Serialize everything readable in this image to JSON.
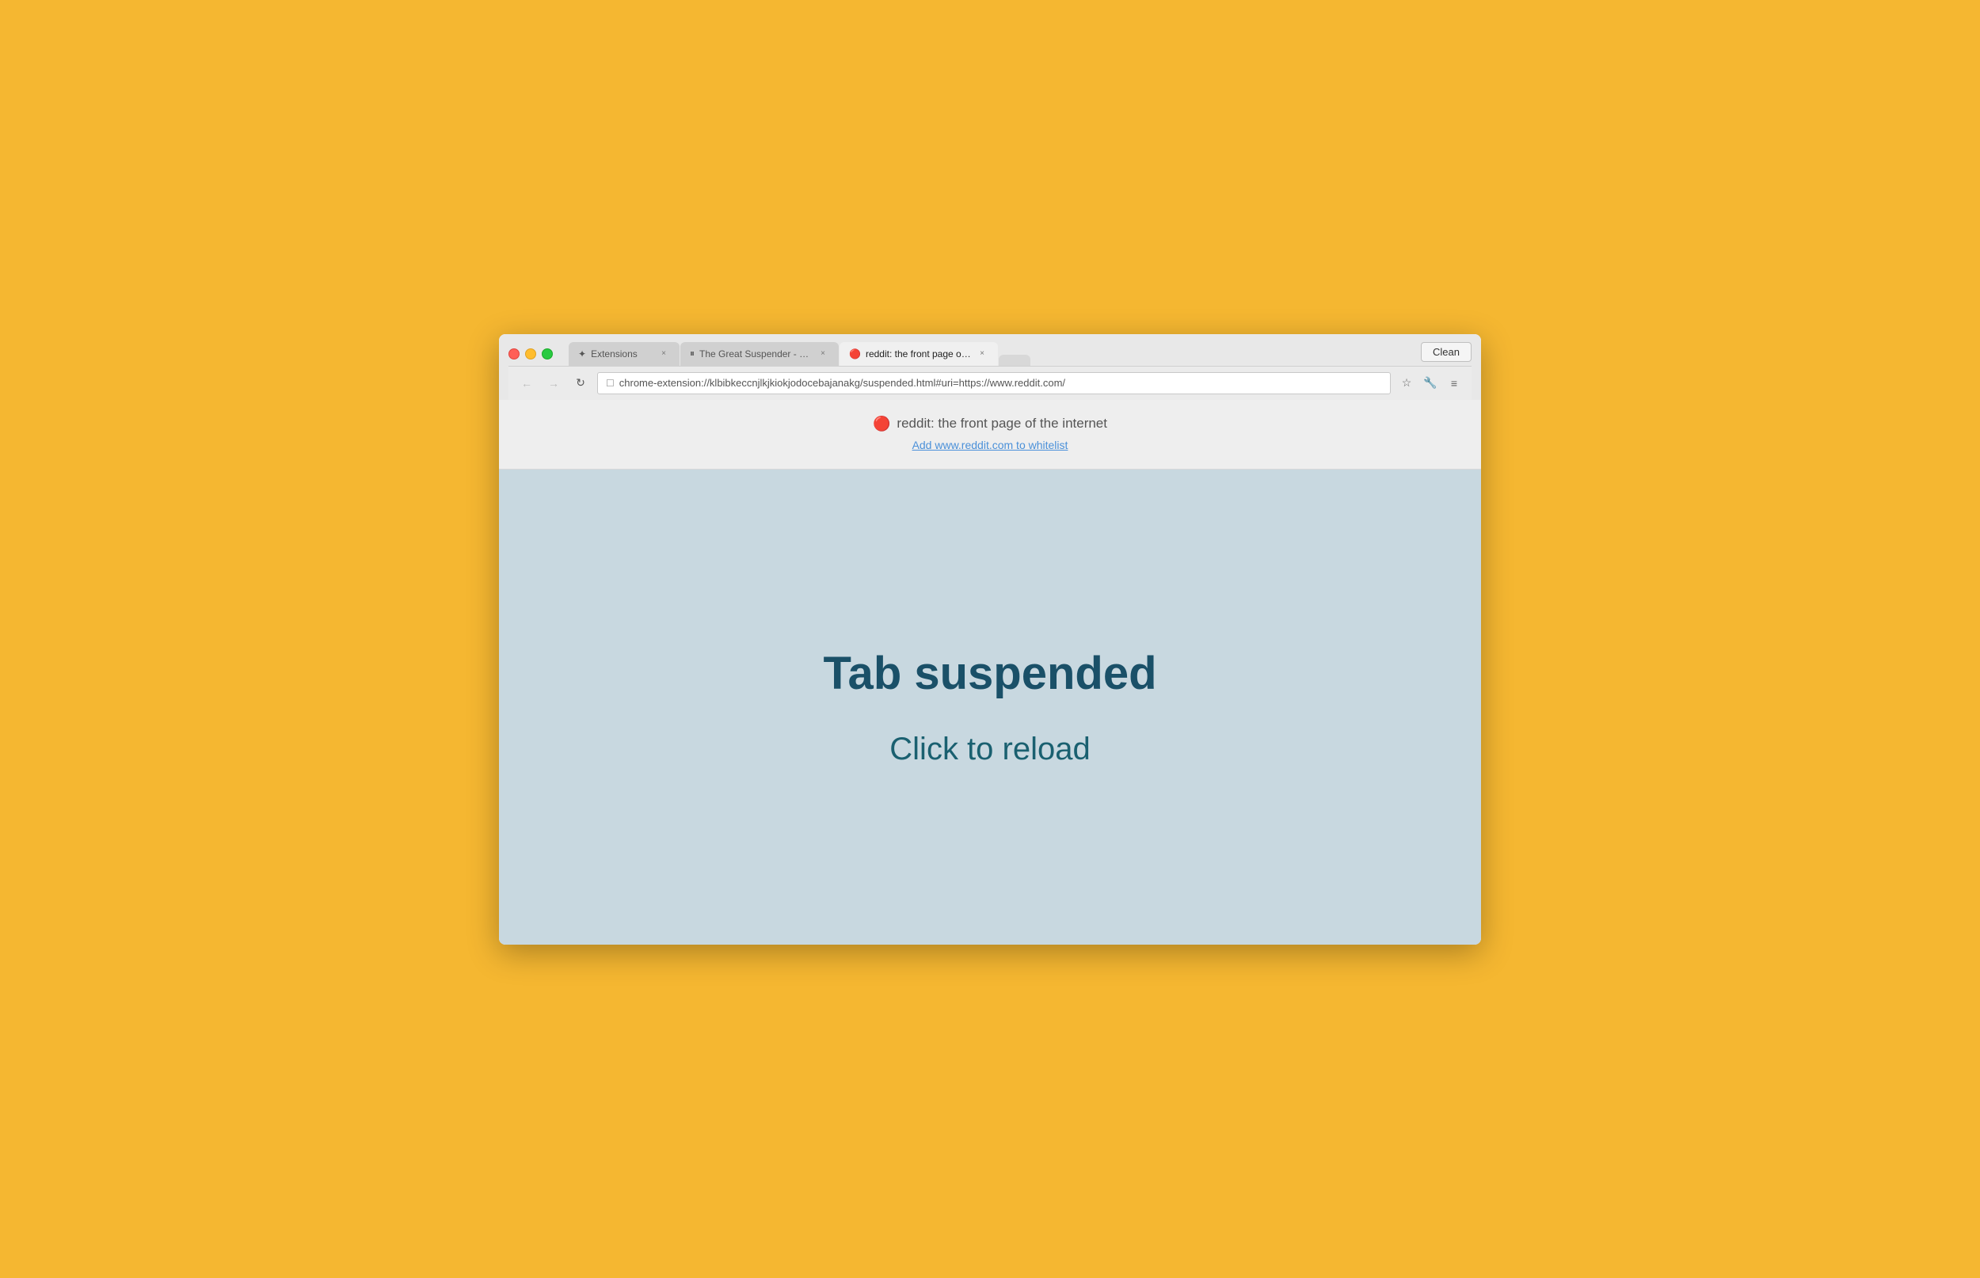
{
  "browser": {
    "background_color": "#F5B731",
    "clean_button_label": "Clean"
  },
  "tabs": [
    {
      "id": "extensions",
      "label": "Extensions",
      "icon": "✦",
      "active": false,
      "close_label": "×"
    },
    {
      "id": "great-suspender",
      "label": "The Great Suspender - Ch…",
      "icon": "⏸",
      "active": false,
      "close_label": "×"
    },
    {
      "id": "reddit",
      "label": "reddit: the front page of th…",
      "icon": "🔴",
      "active": true,
      "close_label": "×"
    },
    {
      "id": "empty",
      "label": "",
      "icon": "",
      "active": false,
      "close_label": ""
    }
  ],
  "nav": {
    "back_icon": "←",
    "forward_icon": "→",
    "reload_icon": "↻",
    "address": "chrome-extension://klbibkeccnjlkjkiokjodocebajanakg/suspended.html#uri=https://www.reddit.com/",
    "address_icon": "🔒",
    "star_icon": "☆",
    "extension_icon": "🔧",
    "menu_icon": "≡"
  },
  "page_header": {
    "reddit_icon": "🔴",
    "title": "reddit: the front page of the internet",
    "whitelist_link": "Add www.reddit.com to whitelist"
  },
  "suspended_page": {
    "heading": "Tab suspended",
    "subheading": "Click to reload"
  }
}
